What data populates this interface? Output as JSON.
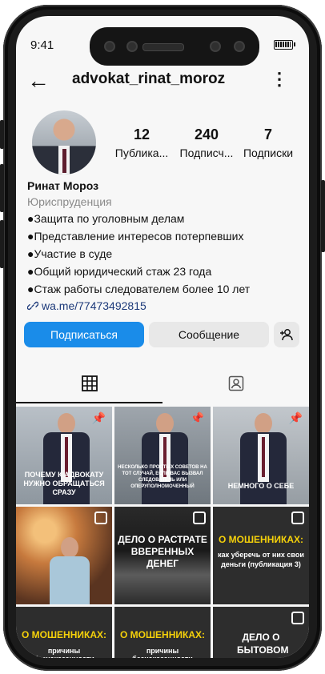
{
  "status": {
    "time": "9:41"
  },
  "header": {
    "back": "←",
    "username": "advokat_rinat_moroz",
    "more": "⋮"
  },
  "stats": [
    {
      "value": "12",
      "label": "Публика..."
    },
    {
      "value": "240",
      "label": "Подписч..."
    },
    {
      "value": "7",
      "label": "Подписки"
    }
  ],
  "profile": {
    "name": "Ринат Мороз",
    "category": "Юриспруденция",
    "bio": [
      "●Защита по уголовным делам",
      "●Представление интересов потерпевших",
      "●Участие в суде",
      "●Общий юридический стаж 23 года",
      "●Стаж работы следователем более 10 лет"
    ],
    "link_icon": "link-icon",
    "link": "wa.me/77473492815"
  },
  "actions": {
    "follow": "Подписаться",
    "message": "Сообщение",
    "add_user": "+"
  },
  "tabs": [
    {
      "icon": "grid-icon"
    },
    {
      "icon": "tagged-icon"
    }
  ],
  "posts": [
    {
      "caption": "ПОЧЕМУ К АДВОКАТУ НУЖНО ОБРАЩАТЬСЯ СРАЗУ",
      "badge": "pin"
    },
    {
      "caption": "НЕСКОЛЬКО ПРОСТЫХ СОВЕТОВ НА ТОТ СЛУЧАЙ, ЕСЛИ ВАС ВЫЗВАЛ СЛЕДОВАТЕЛЬ ИЛИ ОПЕРУПОЛНОМОЧЕННЫЙ",
      "badge": "pin"
    },
    {
      "caption": "НЕМНОГО О СЕБЕ",
      "badge": "pin"
    },
    {
      "caption": "",
      "badge": "multi"
    },
    {
      "caption": "ДЕЛО О РАСТРАТЕ ВВЕРЕННЫХ ДЕНЕГ",
      "badge": "multi"
    },
    {
      "caption": "О МОШЕННИКАХ:",
      "subcaption": "как уберечь от них свои деньги (публикация 3)",
      "badge": "multi"
    },
    {
      "caption": "О МОШЕННИКАХ:",
      "subcaption": "причины безнаказанности",
      "badge": ""
    },
    {
      "caption": "О МОШЕННИКАХ:",
      "subcaption": "причины безнаказанности",
      "badge": ""
    },
    {
      "caption": "ДЕЛО О БЫТОВОМ",
      "badge": "multi"
    }
  ],
  "colors": {
    "accent": "#1a8ce9",
    "caption_yellow": "#f5d10a"
  }
}
